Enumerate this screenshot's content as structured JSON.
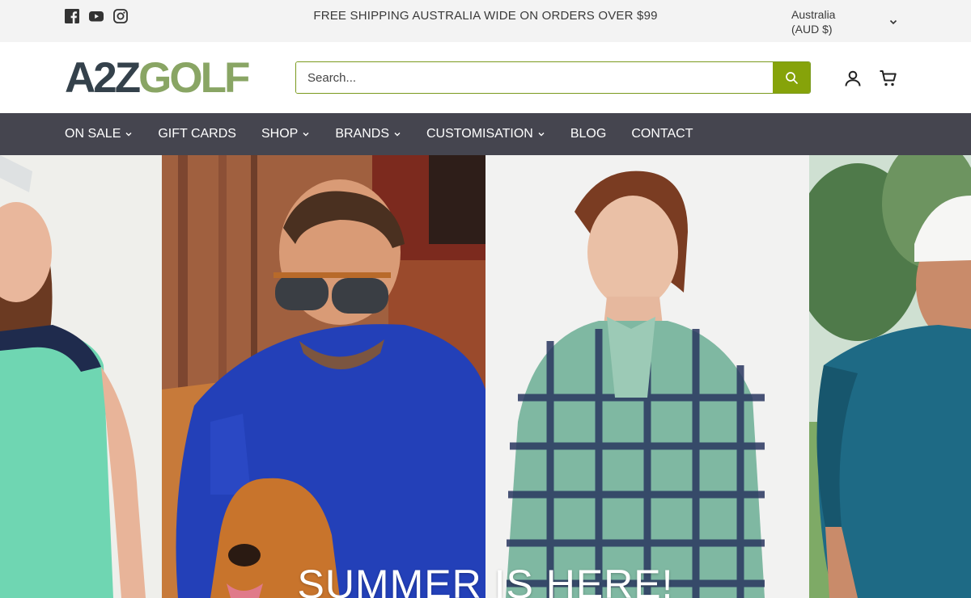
{
  "topbar": {
    "social": [
      "facebook-icon",
      "youtube-icon",
      "instagram-icon"
    ],
    "announcement": "FREE SHIPPING AUSTRALIA WIDE ON ORDERS OVER $99",
    "currency_line1": "Australia",
    "currency_line2": "(AUD $)"
  },
  "header": {
    "logo_part1": "A2Z",
    "logo_part2": "GOLF",
    "search_placeholder": "Search..."
  },
  "nav": {
    "items": [
      {
        "label": "ON SALE",
        "dropdown": true
      },
      {
        "label": "GIFT CARDS",
        "dropdown": false
      },
      {
        "label": "SHOP",
        "dropdown": true
      },
      {
        "label": "BRANDS",
        "dropdown": true
      },
      {
        "label": "CUSTOMISATION",
        "dropdown": true
      },
      {
        "label": "BLOG",
        "dropdown": false
      },
      {
        "label": "CONTACT",
        "dropdown": false
      }
    ]
  },
  "hero": {
    "title": "SUMMER IS HERE!"
  },
  "colors": {
    "accent": "#86a30a",
    "nav_bg": "#45454f",
    "logo_dark": "#34414b",
    "logo_green": "#89a564"
  }
}
